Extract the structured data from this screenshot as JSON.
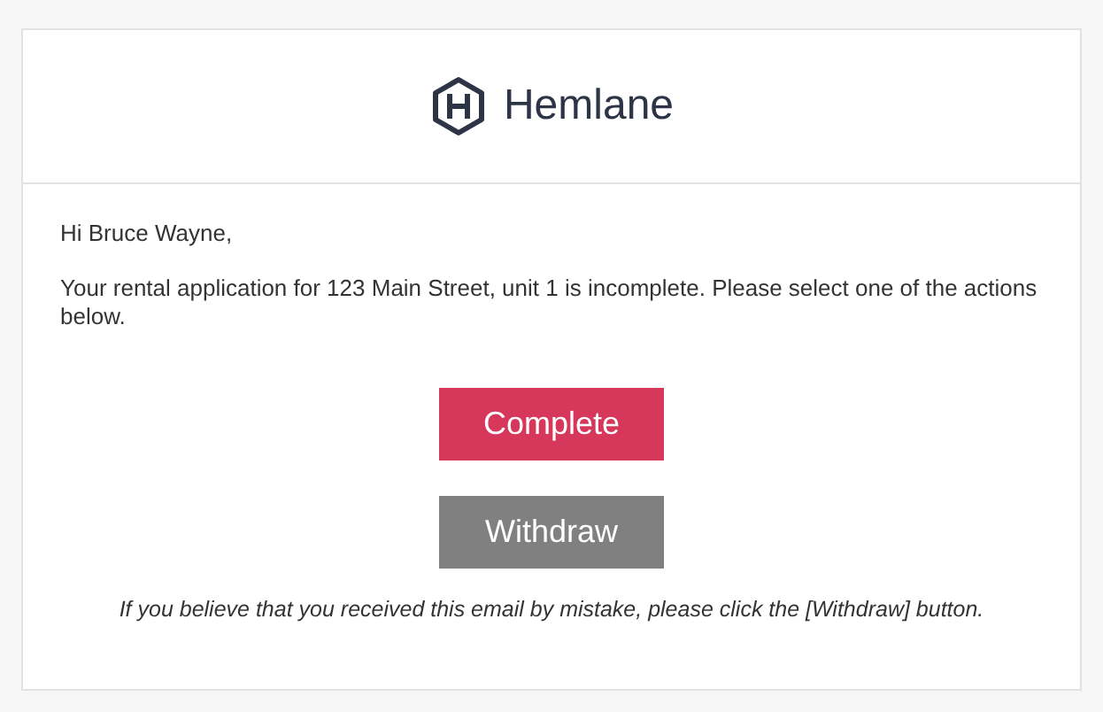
{
  "brand": {
    "name": "Hemlane"
  },
  "greeting": "Hi Bruce Wayne,",
  "message": "Your rental application for 123 Main Street, unit 1 is incomplete. Please select one of the actions below.",
  "buttons": [
    {
      "label": "Complete",
      "kind": "primary"
    },
    {
      "label": "Withdraw",
      "kind": "secondary"
    }
  ],
  "note": "If you believe that you received this email by mistake, please click the [Withdraw] button."
}
